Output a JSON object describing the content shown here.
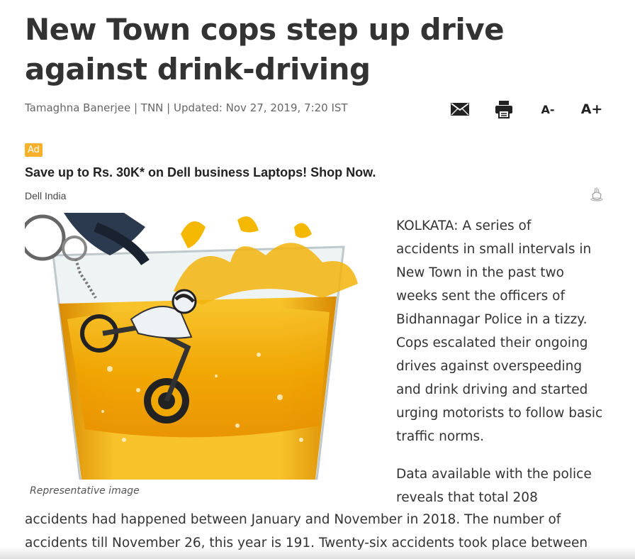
{
  "article": {
    "headline": "New Town cops step up drive against drink-driving",
    "author": "Tamaghna Banerjee",
    "agency": "TNN",
    "updated": "Updated: Nov 27, 2019, 7:20 IST",
    "separator": " | ",
    "tools": {
      "mail_icon": "envelope-icon",
      "print_icon": "printer-icon",
      "font_decrease": "A-",
      "font_increase": "A+"
    },
    "image_caption": "Representative image",
    "side_lines": [
      "KOLKATA: A series of",
      "accidents in small intervals in",
      "New Town in the past two",
      "weeks sent the officers of",
      "Bidhannagar Police in a tizzy.",
      "Cops escalated their ongoing",
      "drives against overspeeding",
      "and drink driving and started",
      "urging motorists to follow basic",
      "traffic norms."
    ],
    "para2_side_lines": [
      "Data available with the police",
      "reveals that total 208"
    ],
    "full_lines": [
      "accidents had happened between January and November in 2018. The number of",
      "accidents till November 26, this year is 191. Twenty-six accidents took place between"
    ]
  },
  "ad": {
    "badge": "Ad",
    "title": "Save up to Rs. 30K* on Dell business Laptops! Shop Now.",
    "source": "Dell India",
    "info_icon": "adchoices-icon"
  },
  "colors": {
    "headline": "#333333",
    "ad_badge": "#f6b02a",
    "beer": "#f0a800"
  }
}
